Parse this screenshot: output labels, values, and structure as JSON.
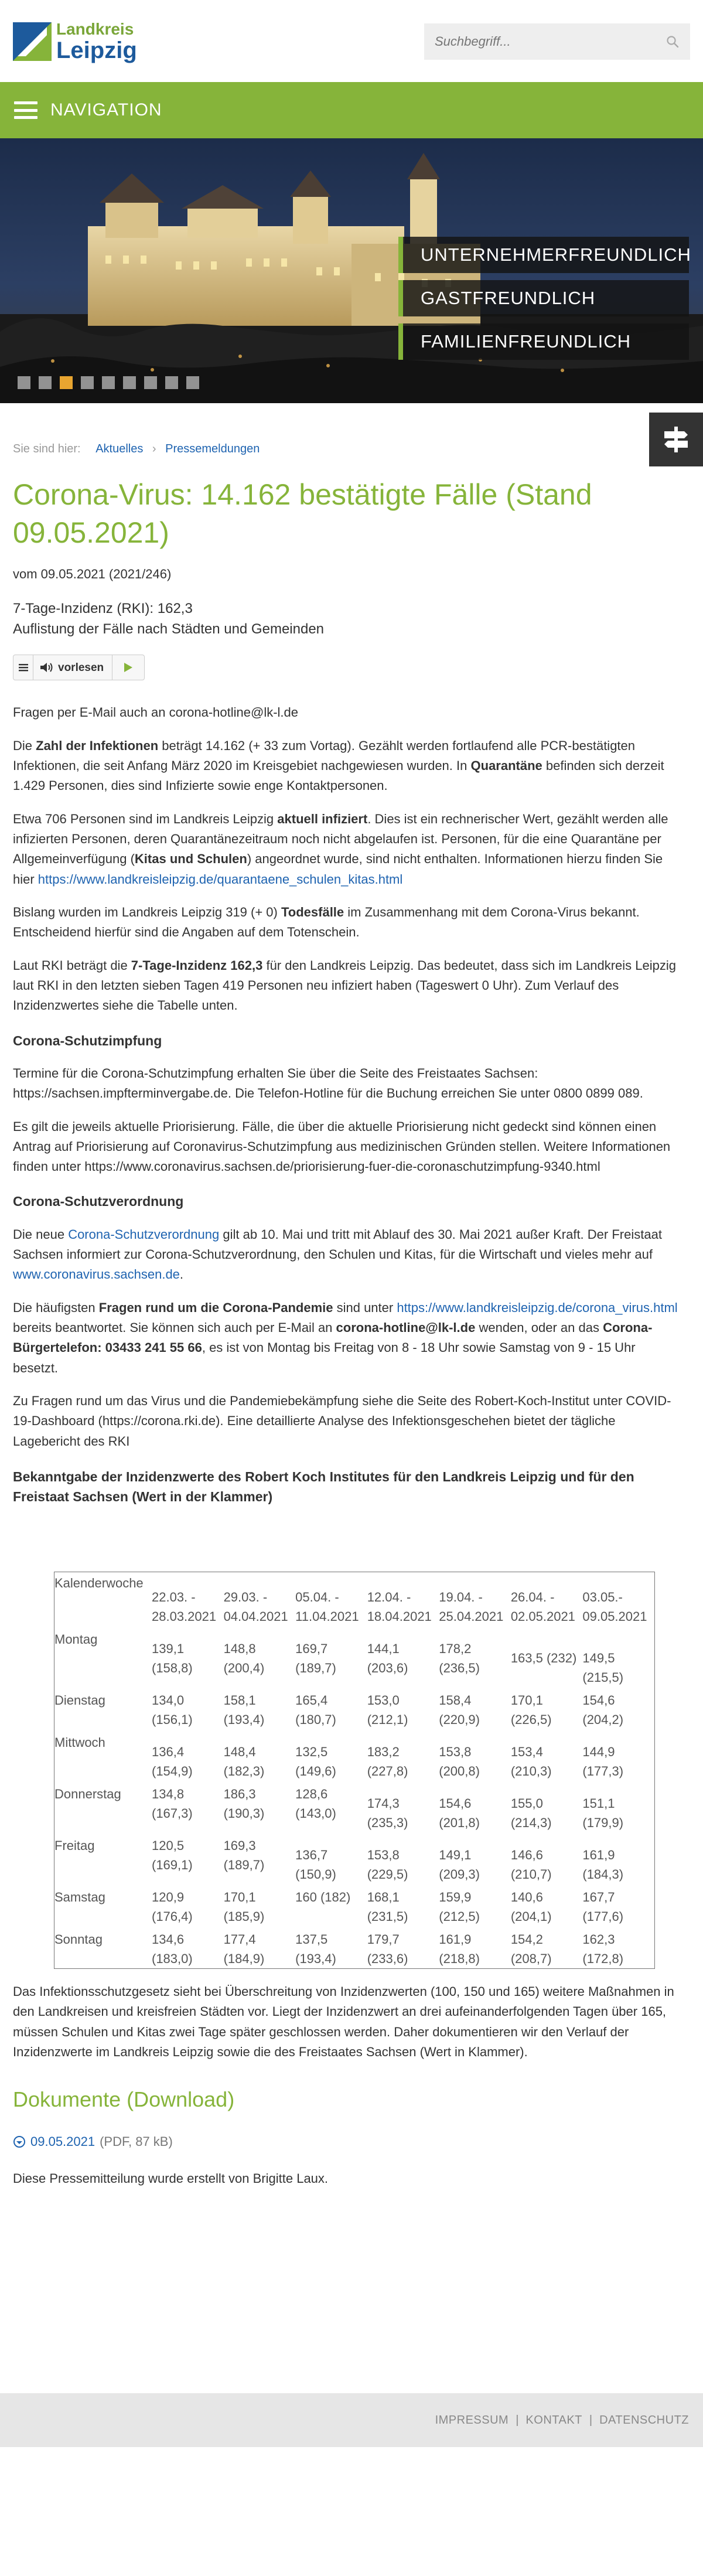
{
  "site": {
    "logo_line1": "Landkreis",
    "logo_line2": "Leipzig",
    "search_placeholder": "Suchbegriff...",
    "nav_label": "NAVIGATION"
  },
  "hero": {
    "claims": [
      "UNTERNEHMERFREUNDLICH",
      "GASTFREUNDLICH",
      "FAMILIENFREUNDLICH"
    ],
    "slides_total": 9,
    "active_slide": 2
  },
  "breadcrumb": {
    "prefix": "Sie sind hier:",
    "items": [
      "Aktuelles",
      "Pressemeldungen"
    ],
    "sep": "›"
  },
  "article": {
    "title": "Corona-Virus: 14.162 bestätigte Fälle (Stand 09.05.2021)",
    "meta": "vom 09.05.2021 (2021/246)",
    "sub1": "7-Tage-Inzidenz (RKI): 162,3",
    "sub2": "Auflistung der Fälle nach Städten und Gemeinden",
    "readspeaker_label": "vorlesen",
    "p_hotline": "Fragen per E-Mail auch an corona-hotline@lk-l.de",
    "p1": {
      "a": "Die ",
      "b": "Zahl der Infektionen",
      "c": " beträgt 14.162 (+ 33 zum Vortag). Gezählt werden fortlaufend alle PCR-bestätigten Infektionen, die seit Anfang März 2020 im Kreisgebiet nachgewiesen wurden. In ",
      "d": "Quarantäne",
      "e": " befinden sich derzeit 1.429 Personen, dies sind Infizierte sowie enge Kontaktpersonen."
    },
    "p2": {
      "a": "Etwa 706 Personen sind im Landkreis Leipzig ",
      "b": "aktuell infiziert",
      "c": ". Dies ist ein rechnerischer Wert, gezählt werden alle infizierten Personen, deren Quarantänezeitraum noch nicht abgelaufen ist. Personen, für die eine Quarantäne per Allgemeinverfügung (",
      "d": "Kitas und Schulen",
      "e": ") angeordnet wurde, sind nicht enthalten. Informationen hierzu finden Sie hier ",
      "link": "https://www.landkreisleipzig.de/quarantaene_schulen_kitas.html"
    },
    "p3": {
      "a": "Bislang wurden im Landkreis Leipzig 319 (+ 0) ",
      "b": "Todesfälle",
      "c": " im Zusammenhang mit dem Corona-Virus bekannt. Entscheidend hierfür sind die Angaben auf dem Totenschein."
    },
    "p4": {
      "a": "Laut RKI beträgt die ",
      "b": "7-Tage-Inzidenz 162,3",
      "c": " für den Landkreis Leipzig. Das bedeutet, dass sich im Landkreis Leipzig laut RKI in den letzten sieben Tagen 419 Personen neu infiziert haben (Tageswert 0 Uhr). Zum Verlauf des Inzidenzwertes siehe die Tabelle unten."
    },
    "h_impfung": "Corona-Schutzimpfung",
    "p5": "Termine für die Corona-Schutzimpfung erhalten Sie über die Seite des Freistaates Sachsen: https://sachsen.impfterminvergabe.de. Die Telefon-Hotline für die Buchung erreichen Sie unter 0800 0899 089.",
    "p6": "Es gilt die jeweils aktuelle Priorisierung. Fälle, die über die aktuelle Priorisierung nicht gedeckt sind können einen Antrag auf Priorisierung auf Coronavirus-Schutzimpfung aus medizinischen Gründen stellen. Weitere Informationen finden unter https://www.coronavirus.sachsen.de/priorisierung-fuer-die-coronaschutzimpfung-9340.html",
    "h_verordnung": "Corona-Schutzverordnung",
    "p7": {
      "a": "Die neue  ",
      "link1": "Corona-Schutzverordnung",
      "b": "  gilt ab 10. Mai und tritt mit Ablauf des 30. Mai 2021 außer Kraft. Der Freistaat Sachsen informiert zur Corona-Schutzverordnung, den Schulen und Kitas, für die Wirtschaft und vieles mehr auf ",
      "link2": "www.coronavirus.sachsen.de",
      "c": "."
    },
    "p8": {
      "a": "Die häufigsten ",
      "b": "Fragen rund um die Corona-Pandemie",
      "c": " sind unter ",
      "link": "https://www.landkreisleipzig.de/corona_virus.html",
      "d": " bereits beantwortet. Sie können sich auch per E-Mail an ",
      "e": "corona-hotline@lk-l.de",
      "f": " wenden, oder an das ",
      "g": "Corona-Bürgertelefon: 03433 241 55 66",
      "h": ", es ist von Montag bis Freitag von 8 - 18 Uhr sowie Samstag von 9 - 15 Uhr besetzt."
    },
    "p9": "Zu Fragen rund um das Virus und die Pandemiebekämpfung siehe die Seite des Robert-Koch-Institut unter COVID-19-Dashboard (https://corona.rki.de). Eine detaillierte Analyse des Infektionsgeschehen bietet der tägliche Lagebericht des RKI",
    "h_table": "Bekanntgabe der Inzidenzwerte des Robert Koch Institutes für den Landkreis Leipzig und für den Freistaat Sachsen (Wert in der Klammer)",
    "p_after": "Das Infektionsschutzgesetz sieht bei Überschreitung von Inzidenzwerten (100, 150 und 165) weitere Maßnahmen in den Landkreisen und kreisfreien Städten vor. Liegt der Inzidenzwert an drei aufeinanderfolgenden Tagen über 165, müssen Schulen und Kitas zwei Tage später geschlossen werden. Daher dokumentieren wir den Verlauf der Inzidenzwerte im Landkreis Leipzig sowie die des Freistaates Sachsen (Wert in Klammer).",
    "docs_heading": "Dokumente (Download)",
    "doc_link": "09.05.2021",
    "doc_size": "(PDF, 87 kB)",
    "author": "Diese Pressemitteilung wurde erstellt von Brigitte Laux."
  },
  "table": {
    "header_label": "Kalenderwoche",
    "weeks": [
      [
        "22.03. -",
        "28.03.2021"
      ],
      [
        "29.03. -",
        "04.04.2021"
      ],
      [
        "05.04. -",
        "11.04.2021"
      ],
      [
        "12.04. -",
        "18.04.2021"
      ],
      [
        "19.04. -",
        "25.04.2021"
      ],
      [
        "26.04. -",
        "02.05.2021"
      ],
      [
        "03.05.-",
        "09.05.2021"
      ]
    ],
    "rows": [
      {
        "day": "Montag",
        "cells": [
          [
            "",
            "139,1",
            "(158,8)"
          ],
          [
            "",
            "148,8",
            "(200,4)"
          ],
          [
            "",
            "169,7",
            "(189,7)"
          ],
          [
            "",
            "144,1",
            "(203,6)"
          ],
          [
            "",
            "178,2",
            "(236,5)"
          ],
          [
            "",
            "",
            "163,5 (232)"
          ],
          [
            "",
            "",
            "149,5",
            "(215,5)"
          ]
        ]
      },
      {
        "day": "Dienstag",
        "cells": [
          [
            "134,0",
            "(156,1)"
          ],
          [
            "158,1",
            "(193,4)"
          ],
          [
            "165,4",
            "(180,7)"
          ],
          [
            "153,0",
            "(212,1)"
          ],
          [
            "158,4",
            "(220,9)"
          ],
          [
            "170,1",
            "(226,5)"
          ],
          [
            "154,6",
            "(204,2)"
          ]
        ]
      },
      {
        "day": "Mittwoch",
        "cells": [
          [
            "",
            "136,4",
            "(154,9)"
          ],
          [
            "",
            "148,4",
            "(182,3)"
          ],
          [
            "",
            "132,5",
            "(149,6)"
          ],
          [
            "",
            "183,2",
            "(227,8)"
          ],
          [
            "",
            "153,8",
            "(200,8)"
          ],
          [
            "",
            "153,4",
            "(210,3)"
          ],
          [
            "",
            "144,9",
            "(177,3)"
          ]
        ]
      },
      {
        "day": "Donnerstag",
        "cells": [
          [
            "134,8",
            "(167,3)"
          ],
          [
            "186,3",
            "(190,3)"
          ],
          [
            "128,6",
            "(143,0)"
          ],
          [
            "",
            "174,3",
            "(235,3)"
          ],
          [
            "",
            "154,6",
            "(201,8)"
          ],
          [
            "",
            "155,0",
            "(214,3)"
          ],
          [
            "",
            "151,1",
            "(179,9)"
          ]
        ]
      },
      {
        "day": "Freitag",
        "cells": [
          [
            "120,5",
            "(169,1)"
          ],
          [
            "169,3",
            "(189,7)"
          ],
          [
            "",
            "136,7",
            "(150,9)"
          ],
          [
            "",
            "153,8",
            "(229,5)"
          ],
          [
            "",
            "149,1",
            "(209,3)"
          ],
          [
            "",
            "146,6",
            "(210,7)"
          ],
          [
            "",
            "161,9",
            "(184,3)"
          ]
        ]
      },
      {
        "day": "Samstag",
        "cells": [
          [
            "120,9",
            "(176,4)"
          ],
          [
            "170,1",
            "(185,9)"
          ],
          [
            "160 (182)"
          ],
          [
            "168,1",
            "(231,5)"
          ],
          [
            "159,9",
            "(212,5)"
          ],
          [
            "140,6",
            "(204,1)"
          ],
          [
            "167,7",
            "(177,6)"
          ]
        ]
      },
      {
        "day": "Sonntag",
        "cells": [
          [
            "134,6",
            "(183,0)"
          ],
          [
            "177,4",
            "(184,9)"
          ],
          [
            "137,5",
            "(193,4)"
          ],
          [
            "179,7",
            "(233,6)"
          ],
          [
            "161,9",
            "(218,8)"
          ],
          [
            "154,2",
            "(208,7)"
          ],
          [
            "162,3",
            "(172,8)"
          ]
        ]
      }
    ]
  },
  "footer": {
    "links": [
      "IMPRESSUM",
      "KONTAKT",
      "DATENSCHUTZ"
    ],
    "sep": "|"
  },
  "colors": {
    "brand_green": "#86b43a",
    "brand_blue": "#1d5a9c",
    "link_blue": "#1e63b0",
    "slider_active": "#e8a530"
  }
}
